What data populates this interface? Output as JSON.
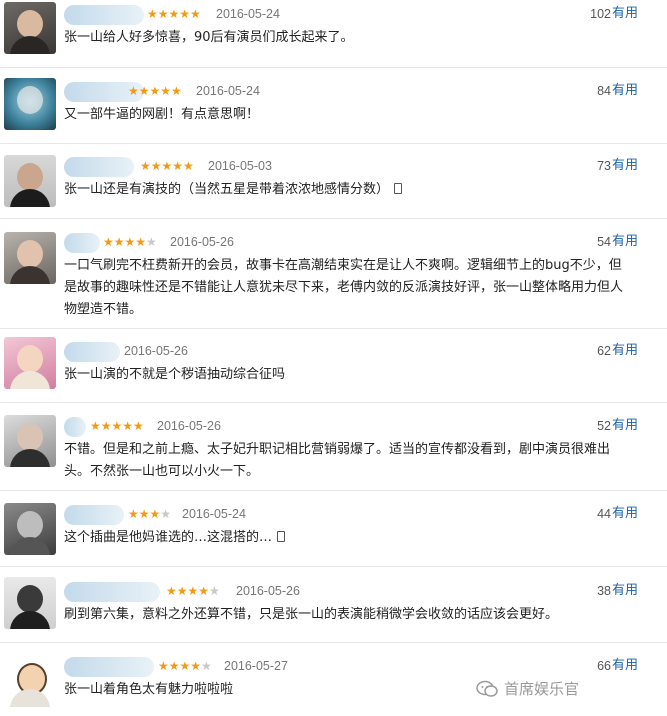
{
  "reviews": [
    {
      "date": "2016-05-24",
      "stars": 5,
      "count": "102",
      "useful": "有用",
      "text": "张一山给人好多惊喜，90后有演员们成长起来了。",
      "avatar": "avatar-1"
    },
    {
      "date": "2016-05-24",
      "stars": 5,
      "count": "84",
      "useful": "有用",
      "text": "又一部牛逼的网剧！有点意思啊！",
      "avatar": "avatar-2"
    },
    {
      "date": "2016-05-03",
      "stars": 5,
      "count": "73",
      "useful": "有用",
      "text": "张一山还是有演技的（当然五星是带着浓浓地感情分数）",
      "avatar": "avatar-3"
    },
    {
      "date": "2016-05-26",
      "stars": 4,
      "count": "54",
      "useful": "有用",
      "text": "一口气刷完不枉费新开的会员，故事卡在高潮结束实在是让人不爽啊。逻辑细节上的bug不少，但是故事的趣味性还是不错能让人意犹未尽下来，老傅内敛的反派演技好评，张一山整体略用力但人物塑造不错。",
      "avatar": "avatar-4"
    },
    {
      "date": "2016-05-26",
      "stars": 0,
      "count": "62",
      "useful": "有用",
      "text": "张一山演的不就是个秽语抽动综合征吗",
      "avatar": "avatar-5"
    },
    {
      "date": "2016-05-26",
      "stars": 5,
      "count": "52",
      "useful": "有用",
      "text": "不错。但是和之前上瘾、太子妃升职记相比营销弱爆了。适当的宣传都没看到，剧中演员很难出头。不然张一山也可以小火一下。",
      "avatar": "avatar-6"
    },
    {
      "date": "2016-05-24",
      "stars": 3,
      "count": "44",
      "useful": "有用",
      "text": "这个插曲是他妈谁选的…这混搭的…",
      "avatar": "avatar-7"
    },
    {
      "date": "2016-05-26",
      "stars": 4,
      "count": "38",
      "useful": "有用",
      "text": "刷到第六集，意料之外还算不错，只是张一山的表演能稍微学会收敛的话应该会更好。",
      "avatar": "avatar-8"
    },
    {
      "date": "2016-05-27",
      "stars": 4,
      "count": "66",
      "useful": "有用",
      "text": "张一山着角色太有魅力啦啦啦",
      "avatar": "avatar-9"
    }
  ],
  "watermark": "首席娱乐官",
  "colors": {
    "star_on": "#f39a12",
    "star_off": "#c8c8c8",
    "useful_link": "#1a62a8"
  }
}
